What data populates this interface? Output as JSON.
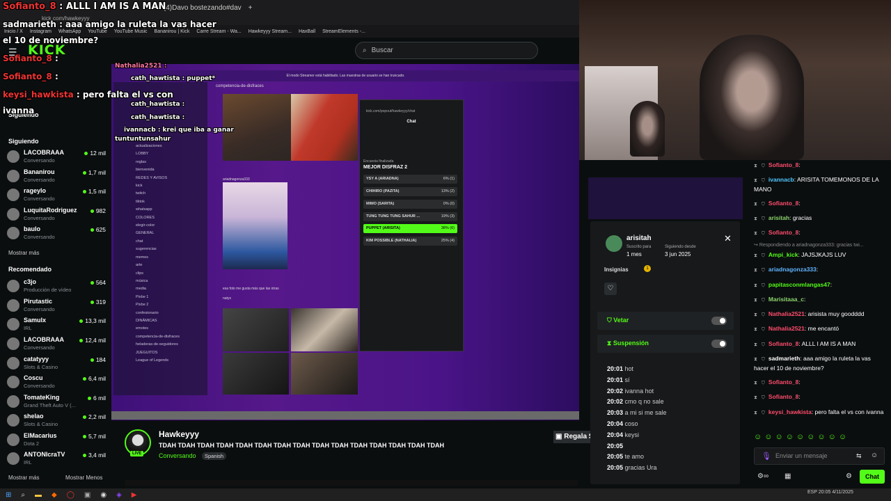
{
  "browser": {
    "tab_left": "Kick",
    "tab_mid": "(4)Davo bostezando#dav",
    "address": "kick.com/hawkeyyy",
    "bookmarks": [
      "Inicio / X",
      "Instagram",
      "WhatsApp",
      "YouTube",
      "YouTube Music",
      "Bananirou | Kick",
      "Carre Stream - Wa...",
      "Hawkeyyy Stream...",
      "HaxBall",
      "StreamElements -..."
    ]
  },
  "topbar": {
    "logo": "KICK",
    "search_placeholder": "Buscar"
  },
  "sidebar": {
    "following_header": "Siguiendo",
    "following": [
      {
        "name": "LACOBRAAA",
        "sub": "Conversando",
        "viewers": "12 mil"
      },
      {
        "name": "Bananirou",
        "sub": "Conversando",
        "viewers": "1,7 mil"
      },
      {
        "name": "rageylo",
        "sub": "Conversando",
        "viewers": "1,5 mil"
      },
      {
        "name": "LuquitaRodriguez",
        "sub": "Conversando",
        "viewers": "982"
      },
      {
        "name": "baulo",
        "sub": "Conversando",
        "viewers": "625"
      }
    ],
    "show_more": "Mostrar más",
    "recommended_header": "Recomendado",
    "recommended": [
      {
        "name": "c3jo",
        "sub": "Producción de vídeo",
        "viewers": "564"
      },
      {
        "name": "Pirutastic",
        "sub": "Conversando",
        "viewers": "319"
      },
      {
        "name": "Samulx",
        "sub": "IRL",
        "viewers": "13,3 mil"
      },
      {
        "name": "LACOBRAAA",
        "sub": "Conversando",
        "viewers": "12,4 mil"
      },
      {
        "name": "catatyyy",
        "sub": "Slots & Casino",
        "viewers": "184"
      },
      {
        "name": "Coscu",
        "sub": "Conversando",
        "viewers": "6,4 mil"
      },
      {
        "name": "TomateKing",
        "sub": "Grand Theft Auto V (...",
        "viewers": "6 mil"
      },
      {
        "name": "shelao",
        "sub": "Slots & Casino",
        "viewers": "2,2 mil"
      },
      {
        "name": "ElMacarius",
        "sub": "Dota 2",
        "viewers": "5,7 mil"
      },
      {
        "name": "ANTONIcraTV",
        "sub": "IRL",
        "viewers": "3,4 mil"
      }
    ],
    "show_more_2": "Mostrar más",
    "show_less": "Mostrar Menos",
    "siguiendo_small": "Siguiendo"
  },
  "overlay_chat": [
    {
      "user": "Sofianto_8",
      "text": "ALLL I AM IS A MAN"
    },
    {
      "user": "sadmarieth",
      "text": "aaa amigo la ruleta la vas hacer"
    },
    {
      "user": "",
      "text": "el 10 de noviembre?"
    },
    {
      "user": "Sofianto_8",
      "text": ""
    },
    {
      "user": "Sofianto_8",
      "text": ""
    },
    {
      "user": "keysi_hawkista",
      "text": "pero falta el vs con"
    },
    {
      "user": "",
      "text": "ivanna"
    }
  ],
  "stream_content": {
    "banner": "El modo Streamer está habilitado. Las muestras de usuario se han truncado.",
    "overlay_top_lines": [
      "Nathalia2521 :",
      "cath_hawtista : puppet*",
      "cath_hawtista :",
      "cath_hawtista :",
      "ivannacb : krei que iba a ganar",
      "tuntuntunsahur"
    ],
    "channel_header": "competencia-de-disfraces",
    "channels": [
      "actualizaciones",
      "LOBBY",
      "reglas",
      "bienvenida",
      "REDES Y AVISOS",
      "kick",
      "twitch",
      "tiktok",
      "whatsapp",
      "COLORES",
      "elegir-color",
      "GENERAL",
      "chat",
      "sugerencias",
      "memes",
      "arte",
      "clips",
      "música",
      "media",
      "Pixbe 1",
      "Pixbe 2",
      "confesionario",
      "DINÁMICAS",
      "emotes",
      "competencia-de-disfraces",
      "heladeras-de-seguidores",
      "JUEGUITOS",
      "League of Legends"
    ],
    "popout_title": "Chat",
    "popout_url": "kick.com/popout/hawkeyyy/chat",
    "poll_closed": "Encuesta finalizada",
    "poll_title": "MEJOR DISFRAZ 2",
    "poll_options": [
      {
        "label": "YSY A (ARIADNA)",
        "result": "6% (1)"
      },
      {
        "label": "CHIHIRO (PAZITA)",
        "result": "13% (2)"
      },
      {
        "label": "MIMO (SARITA)",
        "result": "0% (0)"
      },
      {
        "label": "TUNG TUNG TUNG SAHUR ...",
        "result": "19% (3)"
      },
      {
        "label": "PUPPET (ARISITA)",
        "result": "38% (6)"
      },
      {
        "label": "KIM POSSIBLE (NATHALIA)",
        "result": "25% (4)"
      }
    ],
    "post_user": "ariadnagonza333",
    "post_caption": "esa foto me gusta más que las otras",
    "post_user_2": "natyx"
  },
  "stream_info": {
    "streamer": "Hawkeyyy",
    "title": "TDAH TDAH TDAH TDAH TDAH TDAH TDAH TDAH TDAH TDAH TDAH TDAH TDAH TDAH TDAH",
    "category": "Conversando",
    "language": "Spanish",
    "live": "LIVE",
    "gift_button": "Regala S"
  },
  "mod_panel": {
    "username": "arisitah",
    "subscribed_label": "Suscrito para",
    "subscribed_value": "1 mes",
    "following_label": "Siguiendo desde",
    "following_value": "3 jun 2025",
    "badges_label": "Insignias",
    "ban_label": "Vetar",
    "timeout_label": "Suspensión",
    "log": [
      {
        "time": "20:01",
        "msg": "hot"
      },
      {
        "time": "20:01",
        "msg": "sí"
      },
      {
        "time": "20:02",
        "msg": "ivanna hot"
      },
      {
        "time": "20:02",
        "msg": "cmo q no sale"
      },
      {
        "time": "20:03",
        "msg": "a mi si me sale"
      },
      {
        "time": "20:04",
        "msg": "coso"
      },
      {
        "time": "20:04",
        "msg": "keysi"
      },
      {
        "time": "20:05",
        "msg": ""
      },
      {
        "time": "20:05",
        "msg": "te amo"
      },
      {
        "time": "20:05",
        "msg": "gracias Ura"
      }
    ]
  },
  "chat": {
    "messages": [
      {
        "user": "Sofianto_8",
        "text": "",
        "color": "#ff4d6d"
      },
      {
        "user": "ivannacb",
        "text": "ARISITA TOMEMONOS DE LA MANO",
        "color": "#52c7ff"
      },
      {
        "user": "Sofianto_8",
        "text": "",
        "color": "#ff4d6d"
      },
      {
        "user": "arisitah",
        "text": "gracias",
        "color": "#8bd46b"
      },
      {
        "user": "Sofianto_8",
        "text": "",
        "color": "#ff4d6d"
      },
      {
        "user": "Ampi_kick",
        "text": "JAJSJKAJS LUV",
        "color": "#53fc18"
      },
      {
        "user": "ariadnagonza333",
        "text": "",
        "color": "#5fb4ff"
      },
      {
        "user": "papitasconmlangas47",
        "text": "",
        "color": "#53fc18"
      },
      {
        "user": "Marisitaaa_c",
        "text": "",
        "color": "#8bd46b"
      },
      {
        "user": "Nathalia2521",
        "text": "arisista muy goodddd",
        "color": "#ff4d6d"
      },
      {
        "user": "Nathalia2521",
        "text": "me encantó",
        "color": "#ff4d6d"
      },
      {
        "user": "Sofianto_8",
        "text": "ALLL I AM IS A MAN",
        "color": "#ff4d6d"
      },
      {
        "user": "sadmarieth",
        "text": "aaa amigo la ruleta la vas hacer el 10 de noviembre?",
        "color": "#ffffff"
      },
      {
        "user": "Sofianto_8",
        "text": "",
        "color": "#ff4d6d"
      },
      {
        "user": "Sofianto_8",
        "text": "",
        "color": "#ff4d6d"
      },
      {
        "user": "keysi_hawkista",
        "text": "pero falta el vs con ivanna",
        "color": "#ff4d6d"
      }
    ],
    "reply_to": "Respondiendo a ariadnagonza333: gracias twi...",
    "input_placeholder": "Enviar un mensaje",
    "send_button": "Chat"
  },
  "taskbar": {
    "time": "20:05",
    "date": "4/11/2025",
    "lang": "ESP"
  }
}
